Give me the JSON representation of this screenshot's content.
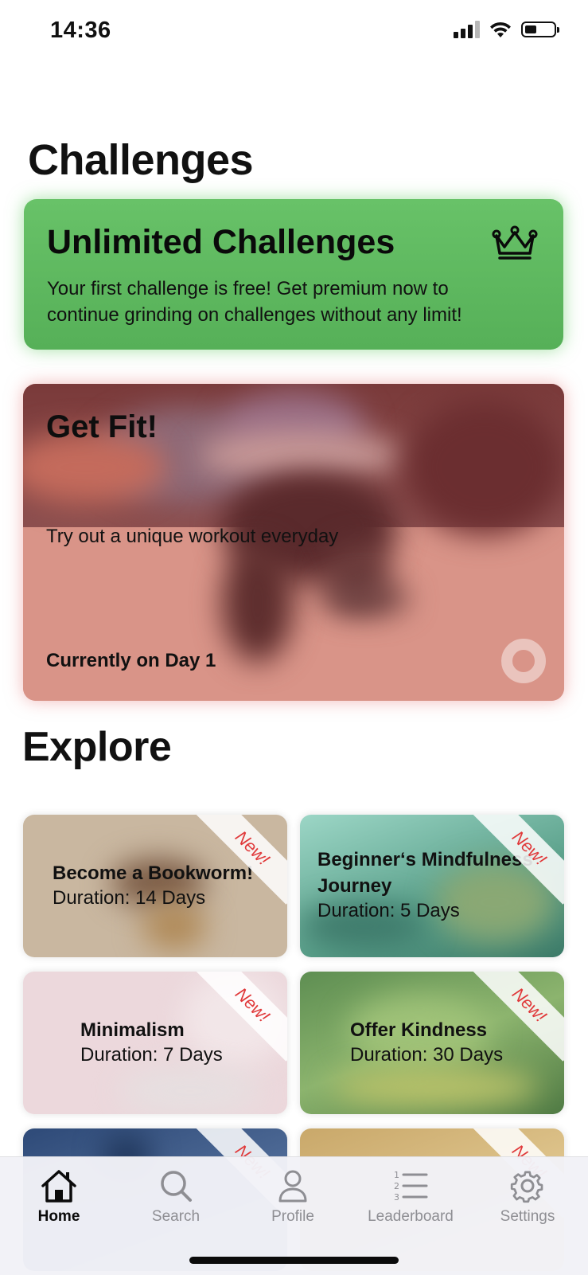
{
  "status_bar": {
    "time": "14:36",
    "battery_level": 0.35
  },
  "page_title": "Challenges",
  "premium_card": {
    "title": "Unlimited Challenges",
    "text": "Your first challenge is free! Get premium now to continue grinding on challenges without any limit!",
    "icon": "crown-icon"
  },
  "featured": {
    "title": "Get Fit!",
    "subtitle": "Try out a unique workout everyday",
    "progress": "Currently on Day 1"
  },
  "explore": {
    "title": "Explore",
    "items": [
      {
        "title": "Become a Bookworm!",
        "duration": "Duration: 14 Days",
        "badge": "New!"
      },
      {
        "title": "Beginner‘s Mindfulness Journey",
        "duration": "Duration: 5 Days",
        "badge": "New!"
      },
      {
        "title": "Minimalism",
        "duration": "Duration: 7 Days",
        "badge": "New!"
      },
      {
        "title": "Offer Kindness",
        "duration": "Duration: 30 Days",
        "badge": "New!"
      },
      {
        "title": "",
        "duration": "",
        "badge": "New!"
      },
      {
        "title": "",
        "duration": "",
        "badge": "New!"
      }
    ]
  },
  "tabs": [
    {
      "label": "Home",
      "icon": "home-icon",
      "active": true
    },
    {
      "label": "Search",
      "icon": "search-icon",
      "active": false
    },
    {
      "label": "Profile",
      "icon": "person-icon",
      "active": false
    },
    {
      "label": "Leaderboard",
      "icon": "list-icon",
      "active": false
    },
    {
      "label": "Settings",
      "icon": "gear-icon",
      "active": false
    }
  ],
  "colors": {
    "premium_green": "#5fb961",
    "featured_red": "#d99286",
    "badge_red": "#e0393a",
    "tab_inactive": "#8e8e93"
  }
}
